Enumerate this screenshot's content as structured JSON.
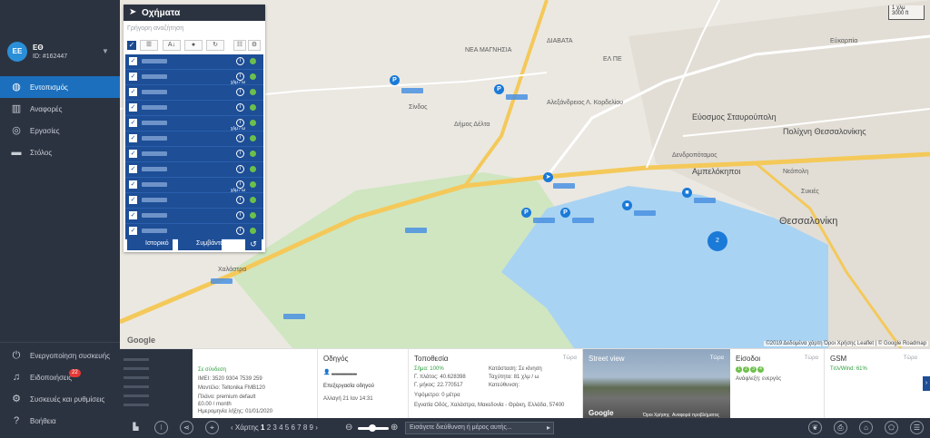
{
  "user": {
    "initials": "EE",
    "name": "ЕΘ",
    "id": "ID: #162447"
  },
  "nav": {
    "items": [
      {
        "label": "Εντοπισμός",
        "icon": "globe-icon"
      },
      {
        "label": "Αναφορές",
        "icon": "chart-icon"
      },
      {
        "label": "Εργασίες",
        "icon": "location-icon"
      },
      {
        "label": "Στόλος",
        "icon": "car-icon"
      }
    ],
    "bottom": [
      {
        "label": "Ενεργοποίηση συσκευής",
        "icon": "plug-icon"
      },
      {
        "label": "Ειδοποιήσεις",
        "icon": "bell-icon",
        "badge": "22"
      },
      {
        "label": "Συσκευές και ρυθμίσεις",
        "icon": "gear-icon"
      },
      {
        "label": "Βοήθεια",
        "icon": "help-icon"
      }
    ]
  },
  "map": {
    "scale_top": "1 χλμ",
    "scale_bottom": "3000 ft",
    "labels": [
      "ΝΕΑ ΜΑΓΝΗΣΙΑ",
      "ΔΙΑΒΑΤΑ",
      "ΕΛ ΠΕ",
      "Εύοσμος Σταυρούπολη",
      "Πολίχνη Θεσσαλονίκης",
      "Αμπελόκηποι",
      "Νεάπολη",
      "Συκιές",
      "Θεσσαλονίκη",
      "Αλεξάνδρειος Λ. Κορδελίου",
      "Σίνδος",
      "Δήμος Δέλτα",
      "Χαλάστρα",
      "Εύκαρπία",
      "Δενδροπόταμος"
    ],
    "attribution": "©2019 Δεδομένα χάρτη  Όροι Χρήσης  Leaflet | © Google Roadmap",
    "google": "Google"
  },
  "vehicles": {
    "title": "Οχήματα",
    "search_placeholder": "Γρήγορη αναζήτηση",
    "speed_unit": "χλμ / ω",
    "history_label": "Ιστορικό",
    "events_label": "Συμβάντα"
  },
  "panel": {
    "device": {
      "status": "Σε σύνδεση",
      "imei": "IMEI: 3520 9304 7539 259",
      "model": "Μοντέλο: Teltonika FMB120",
      "plan": "Πλάνο: premium default",
      "price": "£0.00 / month",
      "expires": "Ημερομηνία λήξης: 01/01/2020"
    },
    "driver": {
      "title": "Οδηγός",
      "assign": "Επεξεργασία οδηγού",
      "last": "Αλλαγή 21 Ιαν 14:31"
    },
    "location": {
      "title": "Τοποθεσία",
      "now": "Τώρα",
      "signal": "Σήμα: 100%",
      "lat": "Γ. πλάτος: 40.628398",
      "lng": "Γ. μήκος: 22.770517",
      "alt": "Υψόμετρο: 0 μέτρα",
      "address": "Εγνατία Οδός, Χαλάστρα, Μακεδονία - Θράκη, Ελλάδα, 57400",
      "state": "Κατάσταση: Σε κίνηση",
      "speed": "Ταχύτητα: 81 χλμ / ω",
      "direction": "Κατεύθυνση:"
    },
    "street": {
      "title": "Street view",
      "now": "Τώρα",
      "google": "Google",
      "terms": "Όροι Χρήσης",
      "report": "Αναφορά προβλήματος"
    },
    "inputs": {
      "title": "Είσοδοι",
      "now": "Τώρα",
      "ignition": "Ανάφλεξη: ενεργός"
    },
    "gsm": {
      "title": "GSM",
      "now": "Τώρα",
      "signal": "Τιτλ/Wind: 61%"
    }
  },
  "bar": {
    "maps_label": "Χάρτης",
    "pages": [
      "1",
      "2",
      "3",
      "4",
      "5",
      "6",
      "7",
      "8",
      "9"
    ],
    "address_placeholder": "Εισάγετε διεύθυνση ή μέρος αυτής..."
  }
}
